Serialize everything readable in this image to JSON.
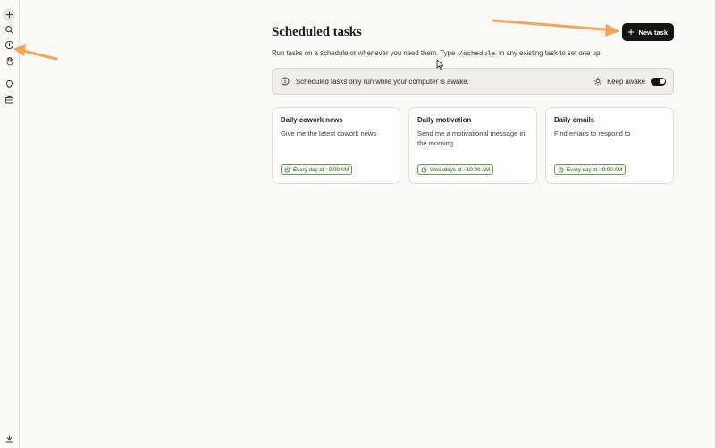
{
  "sidebar": {
    "icons": [
      "plus-icon",
      "search-icon",
      "clock-icon",
      "hand-icon",
      "lightbulb-icon",
      "briefcase-icon",
      "download-icon"
    ]
  },
  "page": {
    "title": "Scheduled tasks",
    "new_task_label": "New task",
    "subtitle_before": "Run tasks on a schedule or whenever you need them. Type ",
    "subtitle_code": "/schedule",
    "subtitle_after": " in any existing task to set one up."
  },
  "notice": {
    "text": "Scheduled tasks only run while your computer is awake.",
    "keep_awake_label": "Keep awake",
    "keep_awake_on": true
  },
  "tasks": [
    {
      "title": "Daily cowork news",
      "description": "Give me the latest cowork news",
      "schedule": "Every day at ~9:00 AM"
    },
    {
      "title": "Daily motivation",
      "description": "Send me a motivational message in the morning",
      "schedule": "Weekdays at ~10:00 AM"
    },
    {
      "title": "Daily emails",
      "description": "Find emails to respond to",
      "schedule": "Every day at ~9:00 AM"
    }
  ],
  "colors": {
    "accent": "#141413",
    "badge_green": "#6a9b5a",
    "annotation_arrow": "#f4a55a",
    "background": "#faf9f5"
  }
}
